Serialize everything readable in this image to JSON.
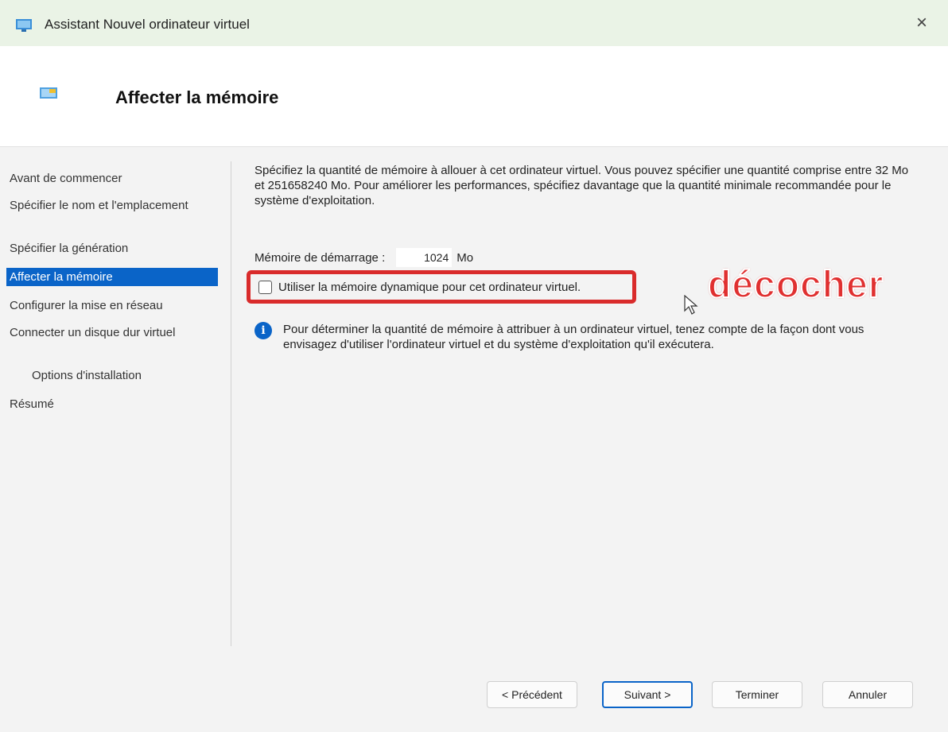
{
  "window": {
    "title": "Assistant Nouvel ordinateur virtuel",
    "close_glyph": "×"
  },
  "header": {
    "title": "Affecter la mémoire",
    "icon": "vm-monitor-icon"
  },
  "nav": {
    "items": [
      {
        "label": "Avant de commencer",
        "selected": false
      },
      {
        "label": "Spécifier le nom et l'emplacement",
        "selected": false
      },
      {
        "label": "Spécifier la génération",
        "selected": false
      },
      {
        "label": "Affecter la mémoire",
        "selected": true
      },
      {
        "label": "Configurer la mise en réseau",
        "selected": false
      },
      {
        "label": "Connecter un disque dur virtuel",
        "selected": false
      },
      {
        "label": "Options d'installation",
        "selected": false,
        "indent": true
      },
      {
        "label": "Résumé",
        "selected": false
      }
    ]
  },
  "content": {
    "intro": "Spécifiez la quantité de mémoire à allouer à cet ordinateur virtuel. Vous pouvez spécifier une quantité comprise entre 32 Mo et 251658240 Mo. Pour améliorer les performances, spécifiez davantage que la quantité minimale recommandée pour le système d'exploitation.",
    "startup_memory_label": "Mémoire de démarrage :",
    "startup_memory_value": "1024",
    "startup_memory_unit": "Mo",
    "dynamic_memory_label": "Utiliser la mémoire dynamique pour cet ordinateur virtuel.",
    "dynamic_memory_checked": false,
    "info_text": "Pour déterminer la quantité de mémoire à attribuer à un ordinateur virtuel, tenez compte de la façon dont vous envisagez d'utiliser l'ordinateur virtuel et du système d'exploitation qu'il exécutera."
  },
  "annotation": {
    "text": "décocher",
    "color": "#e03030"
  },
  "footer": {
    "previous_label": "< Précédent",
    "next_label": "Suivant >",
    "finish_label": "Terminer",
    "cancel_label": "Annuler"
  },
  "colors": {
    "accent": "#0a64c8",
    "highlight_border": "#d92b2b",
    "titlebar_bg": "#eaf3e6"
  }
}
